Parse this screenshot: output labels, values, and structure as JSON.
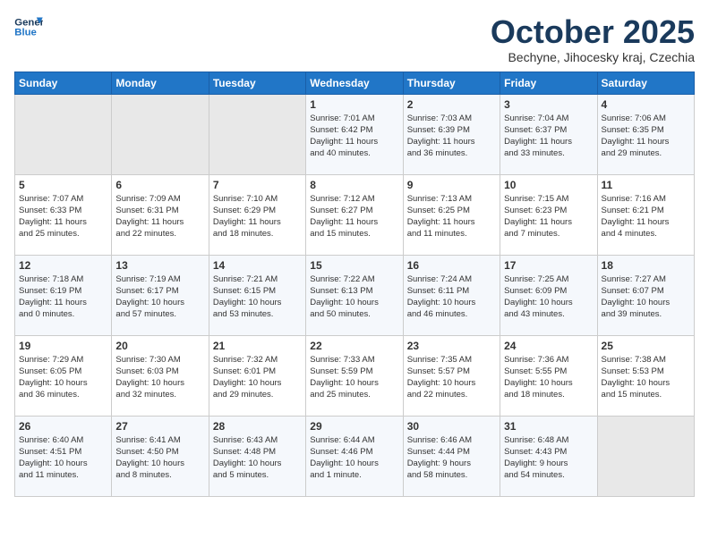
{
  "header": {
    "logo_line1": "General",
    "logo_line2": "Blue",
    "month": "October 2025",
    "location": "Bechyne, Jihocesky kraj, Czechia"
  },
  "days_of_week": [
    "Sunday",
    "Monday",
    "Tuesday",
    "Wednesday",
    "Thursday",
    "Friday",
    "Saturday"
  ],
  "weeks": [
    [
      {
        "num": "",
        "info": ""
      },
      {
        "num": "",
        "info": ""
      },
      {
        "num": "",
        "info": ""
      },
      {
        "num": "1",
        "info": "Sunrise: 7:01 AM\nSunset: 6:42 PM\nDaylight: 11 hours\nand 40 minutes."
      },
      {
        "num": "2",
        "info": "Sunrise: 7:03 AM\nSunset: 6:39 PM\nDaylight: 11 hours\nand 36 minutes."
      },
      {
        "num": "3",
        "info": "Sunrise: 7:04 AM\nSunset: 6:37 PM\nDaylight: 11 hours\nand 33 minutes."
      },
      {
        "num": "4",
        "info": "Sunrise: 7:06 AM\nSunset: 6:35 PM\nDaylight: 11 hours\nand 29 minutes."
      }
    ],
    [
      {
        "num": "5",
        "info": "Sunrise: 7:07 AM\nSunset: 6:33 PM\nDaylight: 11 hours\nand 25 minutes."
      },
      {
        "num": "6",
        "info": "Sunrise: 7:09 AM\nSunset: 6:31 PM\nDaylight: 11 hours\nand 22 minutes."
      },
      {
        "num": "7",
        "info": "Sunrise: 7:10 AM\nSunset: 6:29 PM\nDaylight: 11 hours\nand 18 minutes."
      },
      {
        "num": "8",
        "info": "Sunrise: 7:12 AM\nSunset: 6:27 PM\nDaylight: 11 hours\nand 15 minutes."
      },
      {
        "num": "9",
        "info": "Sunrise: 7:13 AM\nSunset: 6:25 PM\nDaylight: 11 hours\nand 11 minutes."
      },
      {
        "num": "10",
        "info": "Sunrise: 7:15 AM\nSunset: 6:23 PM\nDaylight: 11 hours\nand 7 minutes."
      },
      {
        "num": "11",
        "info": "Sunrise: 7:16 AM\nSunset: 6:21 PM\nDaylight: 11 hours\nand 4 minutes."
      }
    ],
    [
      {
        "num": "12",
        "info": "Sunrise: 7:18 AM\nSunset: 6:19 PM\nDaylight: 11 hours\nand 0 minutes."
      },
      {
        "num": "13",
        "info": "Sunrise: 7:19 AM\nSunset: 6:17 PM\nDaylight: 10 hours\nand 57 minutes."
      },
      {
        "num": "14",
        "info": "Sunrise: 7:21 AM\nSunset: 6:15 PM\nDaylight: 10 hours\nand 53 minutes."
      },
      {
        "num": "15",
        "info": "Sunrise: 7:22 AM\nSunset: 6:13 PM\nDaylight: 10 hours\nand 50 minutes."
      },
      {
        "num": "16",
        "info": "Sunrise: 7:24 AM\nSunset: 6:11 PM\nDaylight: 10 hours\nand 46 minutes."
      },
      {
        "num": "17",
        "info": "Sunrise: 7:25 AM\nSunset: 6:09 PM\nDaylight: 10 hours\nand 43 minutes."
      },
      {
        "num": "18",
        "info": "Sunrise: 7:27 AM\nSunset: 6:07 PM\nDaylight: 10 hours\nand 39 minutes."
      }
    ],
    [
      {
        "num": "19",
        "info": "Sunrise: 7:29 AM\nSunset: 6:05 PM\nDaylight: 10 hours\nand 36 minutes."
      },
      {
        "num": "20",
        "info": "Sunrise: 7:30 AM\nSunset: 6:03 PM\nDaylight: 10 hours\nand 32 minutes."
      },
      {
        "num": "21",
        "info": "Sunrise: 7:32 AM\nSunset: 6:01 PM\nDaylight: 10 hours\nand 29 minutes."
      },
      {
        "num": "22",
        "info": "Sunrise: 7:33 AM\nSunset: 5:59 PM\nDaylight: 10 hours\nand 25 minutes."
      },
      {
        "num": "23",
        "info": "Sunrise: 7:35 AM\nSunset: 5:57 PM\nDaylight: 10 hours\nand 22 minutes."
      },
      {
        "num": "24",
        "info": "Sunrise: 7:36 AM\nSunset: 5:55 PM\nDaylight: 10 hours\nand 18 minutes."
      },
      {
        "num": "25",
        "info": "Sunrise: 7:38 AM\nSunset: 5:53 PM\nDaylight: 10 hours\nand 15 minutes."
      }
    ],
    [
      {
        "num": "26",
        "info": "Sunrise: 6:40 AM\nSunset: 4:51 PM\nDaylight: 10 hours\nand 11 minutes."
      },
      {
        "num": "27",
        "info": "Sunrise: 6:41 AM\nSunset: 4:50 PM\nDaylight: 10 hours\nand 8 minutes."
      },
      {
        "num": "28",
        "info": "Sunrise: 6:43 AM\nSunset: 4:48 PM\nDaylight: 10 hours\nand 5 minutes."
      },
      {
        "num": "29",
        "info": "Sunrise: 6:44 AM\nSunset: 4:46 PM\nDaylight: 10 hours\nand 1 minute."
      },
      {
        "num": "30",
        "info": "Sunrise: 6:46 AM\nSunset: 4:44 PM\nDaylight: 9 hours\nand 58 minutes."
      },
      {
        "num": "31",
        "info": "Sunrise: 6:48 AM\nSunset: 4:43 PM\nDaylight: 9 hours\nand 54 minutes."
      },
      {
        "num": "",
        "info": ""
      }
    ]
  ]
}
